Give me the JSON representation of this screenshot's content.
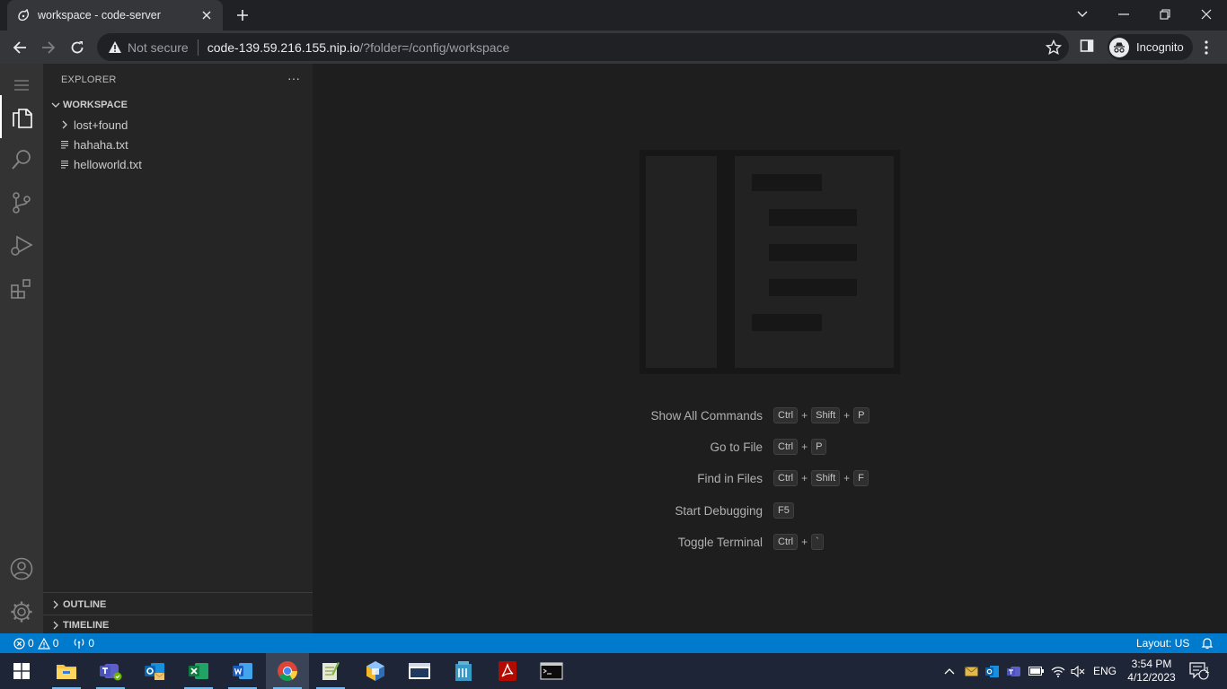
{
  "browser": {
    "tab_title": "workspace - code-server",
    "security_label": "Not secure",
    "url_host": "code-139.59.216.155.nip.io",
    "url_path": "/?folder=/config/workspace",
    "profile_label": "Incognito"
  },
  "explorer": {
    "header": "EXPLORER",
    "more": "···",
    "workspace_label": "WORKSPACE",
    "items": [
      {
        "name": "lost+found",
        "kind": "folder"
      },
      {
        "name": "hahaha.txt",
        "kind": "file"
      },
      {
        "name": "helloworld.txt",
        "kind": "file"
      }
    ],
    "outline_label": "OUTLINE",
    "timeline_label": "TIMELINE"
  },
  "editor": {
    "shortcuts": [
      {
        "label": "Show All Commands",
        "keys": [
          "Ctrl",
          "Shift",
          "P"
        ]
      },
      {
        "label": "Go to File",
        "keys": [
          "Ctrl",
          "P"
        ]
      },
      {
        "label": "Find in Files",
        "keys": [
          "Ctrl",
          "Shift",
          "F"
        ]
      },
      {
        "label": "Start Debugging",
        "keys": [
          "F5"
        ]
      },
      {
        "label": "Toggle Terminal",
        "keys": [
          "Ctrl",
          "`"
        ]
      }
    ]
  },
  "statusbar": {
    "errors": "0",
    "warnings": "0",
    "ports": "0",
    "layout": "Layout: US"
  },
  "taskbar": {
    "language": "ENG",
    "time": "3:54 PM",
    "date": "4/12/2023",
    "notifications": "1"
  },
  "colors": {
    "statusbar": "#007acc",
    "activitybar": "#333333",
    "sidebar": "#252526",
    "editor": "#1e1e1e",
    "taskbar": "#1d2536"
  }
}
